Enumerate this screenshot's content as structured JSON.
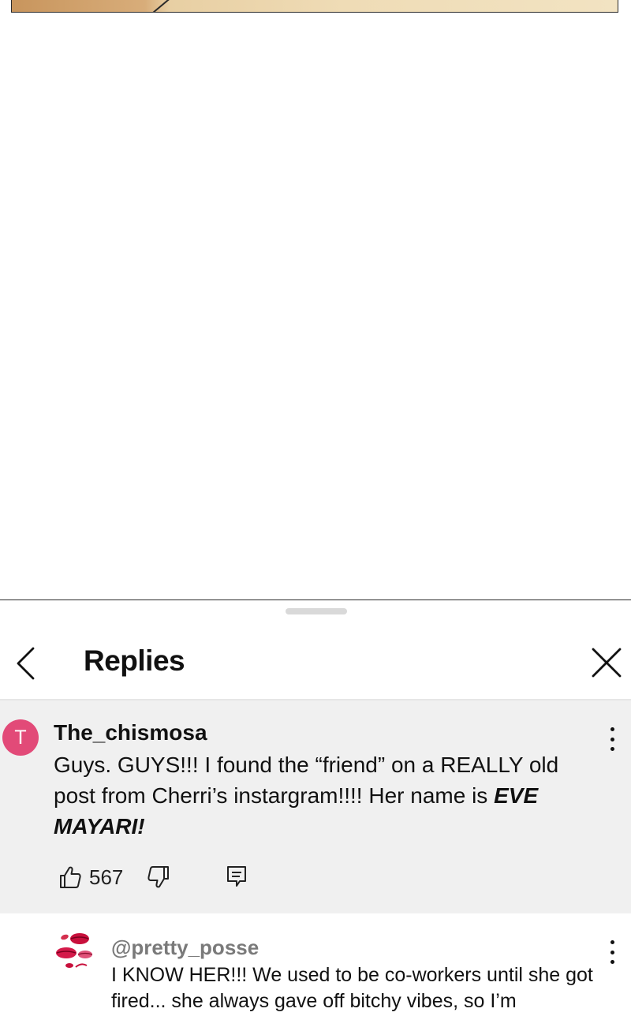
{
  "header": {
    "title": "Replies",
    "back_icon": "chevron-left-icon",
    "close_icon": "close-icon"
  },
  "comment": {
    "avatar_letter": "T",
    "avatar_color": "#e24a78",
    "username": "The_chismosa",
    "text_plain": "Guys. GUYS!!! I found the “friend” on a REALLY old post from Cherri’s instargram!!!! Her name is ",
    "text_emphasis": "EVE MAYARI!",
    "like_count": "567"
  },
  "reply": {
    "username": "@pretty_posse",
    "text": "I KNOW HER!!! We used to be co-workers until she got fired... she always gave off bitchy vibes, so I’m"
  },
  "colors": {
    "sheet_bg": "#ffffff",
    "comment_bg": "#f0f0f0",
    "reply_username": "#7a7a7a"
  }
}
